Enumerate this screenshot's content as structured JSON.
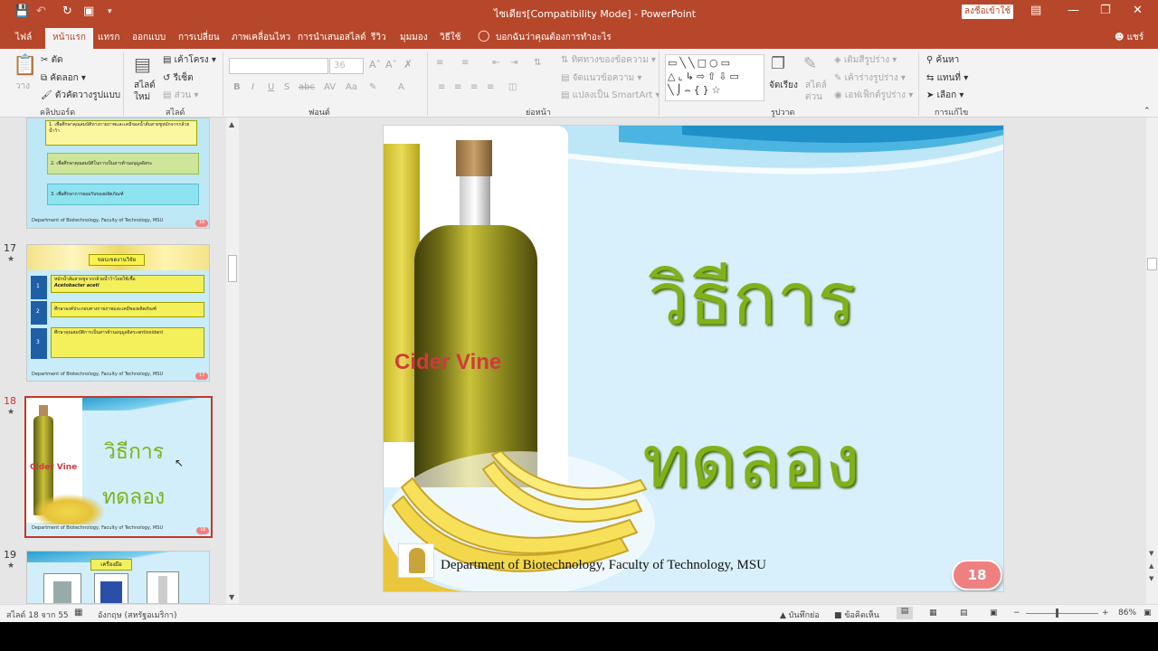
{
  "window": {
    "title": "ไซเดียร[Compatibility Mode]  -  PowerPoint",
    "signin_label": "ลงชื่อเข้าใช้",
    "qa_icons": [
      "save-icon",
      "undo-icon",
      "redo-icon",
      "present-icon"
    ]
  },
  "menu": {
    "items": [
      "ไฟล์",
      "หน้าแรก",
      "แทรก",
      "ออกแบบ",
      "การเปลี่ยน",
      "ภาพเคลื่อนไหว",
      "การนำเสนอสไลด์",
      "รีวิว",
      "มุมมอง",
      "วิธีใช้"
    ],
    "tell_me": "บอกฉันว่าคุณต้องการทำอะไร",
    "share": "แชร์"
  },
  "ribbon": {
    "clipboard": {
      "paste": "วาง",
      "cut": "ตัด",
      "copy": "คัดลอก",
      "format_painter": "ตัวคัดวางรูปแบบ",
      "label": "คลิปบอร์ด"
    },
    "slides": {
      "new_slide_line1": "สไลด์",
      "new_slide_line2": "ใหม่",
      "layout": "เค้าโครง",
      "reset": "รีเซ็ต",
      "section": "ส่วน",
      "label": "สไลด์"
    },
    "font": {
      "size": "36",
      "label": "ฟอนต์"
    },
    "paragraph": {
      "text_direction": "ทิศทางของข้อความ",
      "align_text": "จัดแนวข้อความ",
      "smartart": "แปลงเป็น SmartArt",
      "label": "ย่อหน้า"
    },
    "drawing": {
      "arrange": "จัดเรียง",
      "quick_styles_line1": "สไตล์",
      "quick_styles_line2": "ด่วน",
      "shape_fill": "เติมสีรูปร่าง",
      "shape_outline": "เค้าร่างรูปร่าง",
      "shape_effects": "เอฟเฟ็กต์รูปร่าง",
      "label": "รูปวาด"
    },
    "editing": {
      "find": "ค้นหา",
      "replace": "แทนที่",
      "select": "เลือก",
      "label": "การแก้ไข"
    }
  },
  "thumbnails": {
    "t16": {
      "items": [
        "1. เพื่อศึกษาคุณสมบัติทางกายภาพและเคมีของน้ำส้มสายชูหมักจากกล้วยน้ำว้า",
        "2. เพื่อศึกษาคุณสมบัติในการเป็นสารต้านอนุมูลอิสระ",
        "3. เพื่อศึกษาการยอมรับของผลิตภัณฑ์"
      ],
      "footer": "Department of Biotechnology, Faculty of Technology, MSU",
      "badge": "16"
    },
    "t17": {
      "number": "17",
      "title": "ขอบเขตงานวิจัย",
      "items": [
        "หมักน้ำส้มสายชูจากกล้วยน้ำว้าโดยใช้เชื้อ",
        "Acetobacter aceti",
        "ศึกษาองค์ประกอบทางกายภาพและเคมีของผลิตภัณฑ์",
        "ศึกษาคุณสมบัติการเป็นสารต้านอนุมูลอิสระantioxidant"
      ],
      "steps": [
        "1",
        "2",
        "3"
      ],
      "footer": "Department of Biotechnology, Faculty of Technology, MSU",
      "badge": "17"
    },
    "t18": {
      "number": "18",
      "title_line1": "วิธีการ",
      "title_line2": "ทดลอง",
      "bottle_text": "Cider Vine",
      "footer": "Department of Biotechnology, Faculty of Technology, MSU",
      "badge": "18"
    },
    "t19": {
      "number": "19",
      "title": "เครื่องมือ"
    }
  },
  "slide": {
    "title_line1": "วิธีการ",
    "title_line2": "ทดลอง",
    "bottle_text": "Cider Vine",
    "footer": "Department  of  Biotechnology, Faculty of Technology, MSU",
    "badge": "18",
    "colors": {
      "title": "#7fb21a",
      "badge": "#f08080",
      "bg": "#d7f0fb"
    }
  },
  "status": {
    "slide_info": "สไลด์ 18 จาก 55",
    "language": "อังกฤษ (สหรัฐอเมริกา)",
    "notes": "บันทึกย่อ",
    "comments": "ข้อคิดเห็น",
    "zoom": "86%",
    "zoom_level": 0.86
  }
}
